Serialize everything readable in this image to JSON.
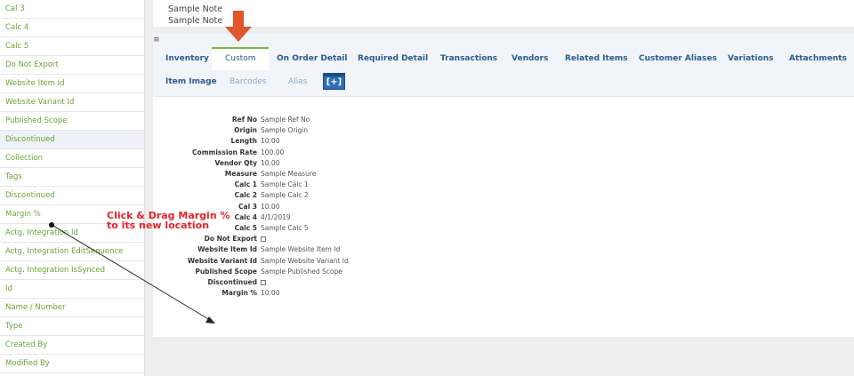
{
  "sidebar": {
    "items": [
      {
        "label": "Cal 3",
        "highlight": false
      },
      {
        "label": "Calc 4",
        "highlight": false
      },
      {
        "label": "Calc 5",
        "highlight": false
      },
      {
        "label": "Do Not Export",
        "highlight": false
      },
      {
        "label": "Website Item Id",
        "highlight": false
      },
      {
        "label": "Website Variant Id",
        "highlight": false
      },
      {
        "label": "Published Scope",
        "highlight": false
      },
      {
        "label": "Discontinued",
        "highlight": true
      },
      {
        "label": "Collection",
        "highlight": false
      },
      {
        "label": "Tags",
        "highlight": false
      },
      {
        "label": "Discontinued",
        "highlight": false
      },
      {
        "label": "Margin %",
        "highlight": false
      },
      {
        "label": "Actg. Integration Id",
        "highlight": false
      },
      {
        "label": "Actg. Integration EditSequence",
        "highlight": false
      },
      {
        "label": "Actg. Integration IsSynced",
        "highlight": false
      },
      {
        "label": "Id",
        "highlight": false
      },
      {
        "label": "Name / Number",
        "highlight": false
      },
      {
        "label": "Type",
        "highlight": false
      },
      {
        "label": "Created By",
        "highlight": false
      },
      {
        "label": "Modified By",
        "highlight": false
      }
    ]
  },
  "notes": [
    "Sample Note",
    "Sample Note"
  ],
  "tabs_row1": [
    "Inventory",
    "Custom",
    "On Order Detail",
    "Required Detail",
    "Transactions",
    "Vendors",
    "Related Items",
    "Customer Aliases",
    "Variations",
    "Attachments"
  ],
  "tabs_row2": [
    "Item Image",
    "Barcodes",
    "Alias"
  ],
  "active_tab": "Custom",
  "add_tab_icon": "add-tab-icon",
  "fields": [
    {
      "label": "Ref No",
      "value": "Sample Ref No"
    },
    {
      "label": "Origin",
      "value": "Sample Origin"
    },
    {
      "label": "Length",
      "value": "10.00"
    },
    {
      "label": "Commission Rate",
      "value": "100.00"
    },
    {
      "label": "Vendor Qty",
      "value": "10.00"
    },
    {
      "label": "Measure",
      "value": "Sample Measure"
    },
    {
      "label": "Calc 1",
      "value": "Sample Calc 1"
    },
    {
      "label": "Calc 2",
      "value": "Sample Calc 2"
    },
    {
      "label": "Cal 3",
      "value": "10.00"
    },
    {
      "label": "Calc 4",
      "value": "4/1/2019"
    },
    {
      "label": "Calc 5",
      "value": "Sample Calc 5"
    },
    {
      "label": "Do Not Export",
      "value": "",
      "checkbox": true
    },
    {
      "label": "Website Item Id",
      "value": "Sample Website Item Id"
    },
    {
      "label": "Website Variant Id",
      "value": "Sample Website Variant Id"
    },
    {
      "label": "Published Scope",
      "value": "Sample Published Scope"
    },
    {
      "label": "Discontinued",
      "value": "",
      "checkbox": true
    },
    {
      "label": "Margin %",
      "value": "10.00"
    }
  ],
  "annotation": {
    "line1": "Click & Drag Margin %",
    "line2": "to its new location",
    "color": "#e8232a"
  },
  "colors": {
    "sidebar_text": "#6aa336",
    "tab_text": "#2c5a8a",
    "tab_active_border": "#7ab648",
    "pointer_arrow": "#e0552b"
  }
}
